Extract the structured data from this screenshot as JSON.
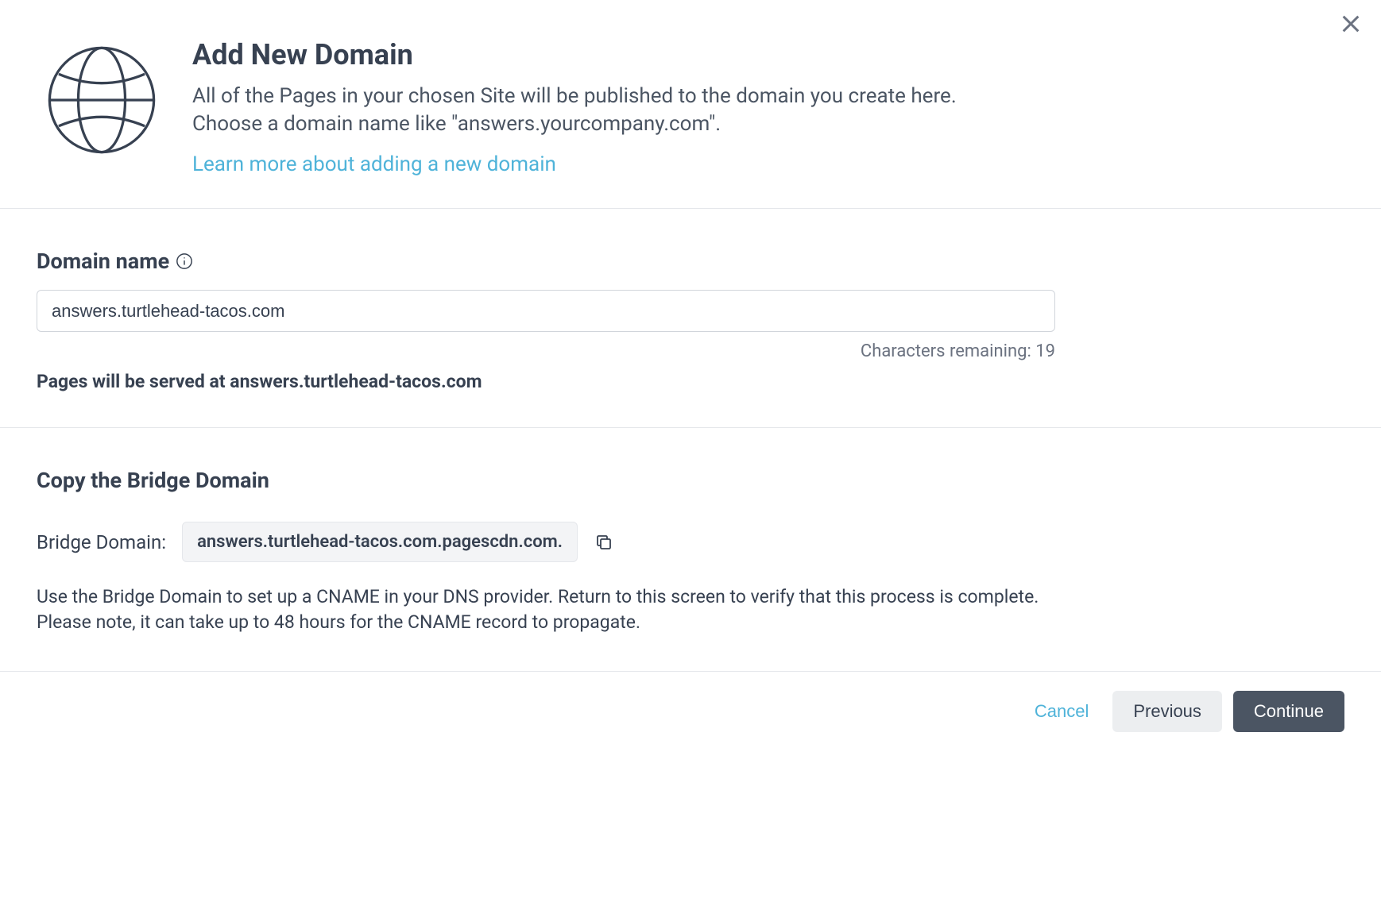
{
  "header": {
    "title": "Add New Domain",
    "description": "All of the Pages in your chosen Site will be published to the domain you create here. Choose a domain name like \"answers.yourcompany.com\".",
    "learn_more": "Learn more about adding a new domain"
  },
  "domain_section": {
    "label": "Domain name",
    "value": "answers.turtlehead-tacos.com",
    "chars_remaining": "Characters remaining: 19",
    "serve_text": "Pages will be served at answers.turtlehead-tacos.com"
  },
  "bridge_section": {
    "title": "Copy the Bridge Domain",
    "label": "Bridge Domain:",
    "value": "answers.turtlehead-tacos.com.pagescdn.com.",
    "help": "Use the Bridge Domain to set up a CNAME in your DNS provider. Return to this screen to verify that this process is complete. Please note, it can take up to 48 hours for the CNAME record to propagate."
  },
  "footer": {
    "cancel": "Cancel",
    "previous": "Previous",
    "continue": "Continue"
  }
}
